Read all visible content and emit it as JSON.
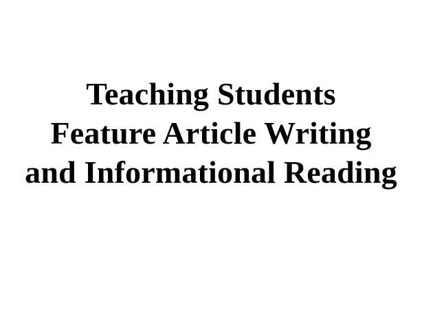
{
  "document": {
    "title_lines": [
      "Teaching Students",
      "Feature Article Writing",
      "and Informational Reading"
    ]
  },
  "colors": {
    "background": "#ffffff",
    "text": "#000000"
  }
}
